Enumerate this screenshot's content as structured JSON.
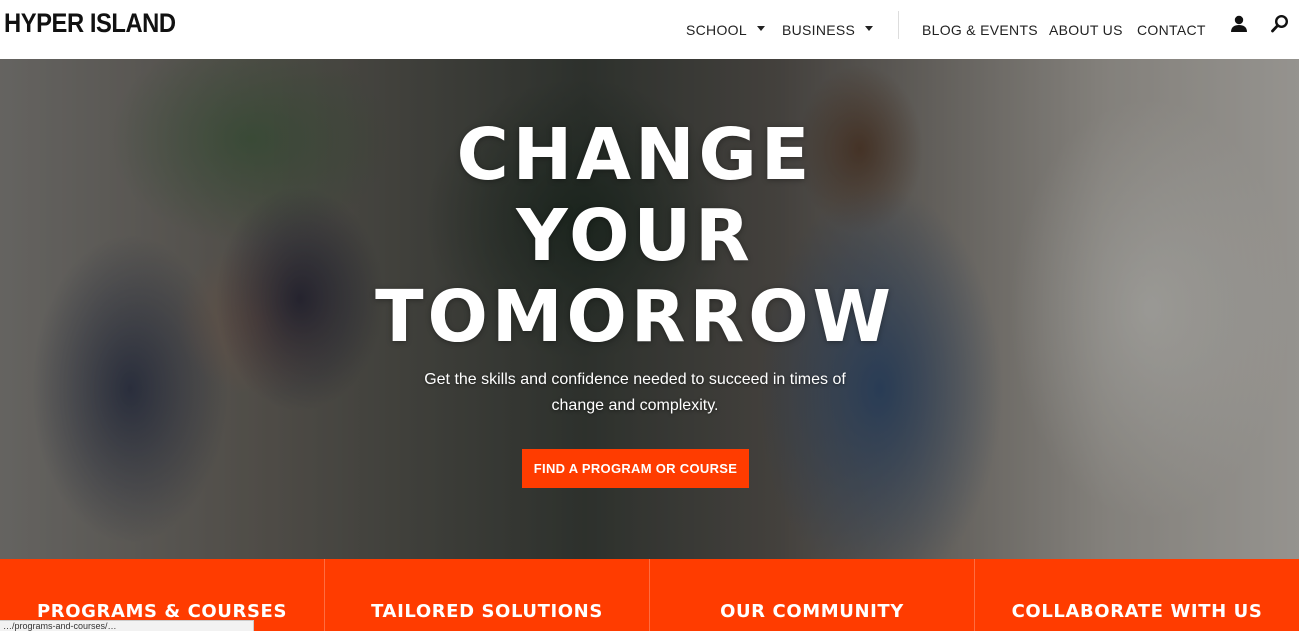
{
  "header": {
    "logo": "HYPER ISLAND",
    "nav": {
      "school": "SCHOOL",
      "business": "BUSINESS",
      "blog_events": "BLOG & EVENTS",
      "about_us": "ABOUT US",
      "contact": "CONTACT"
    },
    "icons": {
      "user": "user-icon",
      "search": "search-icon"
    }
  },
  "hero": {
    "title_lines": [
      "CHANGE",
      "YOUR",
      "TOMORROW"
    ],
    "subtitle_line1": "Get the skills and confidence needed to succeed in times of",
    "subtitle_line2": "change and complexity.",
    "cta": "FIND A PROGRAM OR COURSE"
  },
  "bottom_bar": {
    "items": [
      "PROGRAMS & COURSES",
      "TAILORED SOLUTIONS",
      "OUR COMMUNITY",
      "COLLABORATE WITH US"
    ]
  },
  "status_bar": {
    "url": "…/programs-and-courses/…"
  },
  "colors": {
    "accent": "#ff3c00",
    "text": "#222222",
    "background": "#ffffff"
  }
}
